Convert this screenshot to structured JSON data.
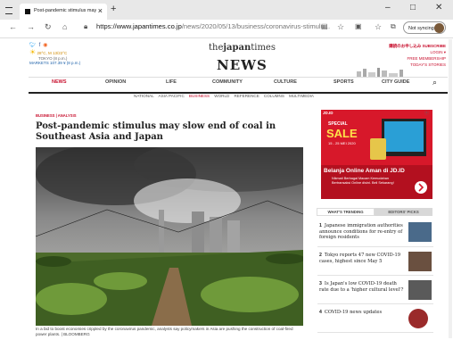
{
  "browser": {
    "tab_title": "Post-pandemic stimulus may slo",
    "new_tab": "+",
    "url_scheme": "https://",
    "url_domain": "www.japantimes.co.jp",
    "url_path": "/news/2020/05/13/business/coronavirus-stimulu...",
    "sync_label": "Not syncing",
    "window_min": "–",
    "window_max": "□",
    "window_close": "✕"
  },
  "header": {
    "weather_temp": "28°C, M 13/22°C",
    "weather_city": "TOKYO (8 p.m.)",
    "markets": "MARKETS  107.39 ¥ (8 p.m.)",
    "logo_the": "the",
    "logo_japan": "japan",
    "logo_times": "times",
    "section": "NEWS",
    "right_links": [
      "購読のお申し込み SUBSCRIBE",
      "LOGIN ▾",
      "FREE MEMBERSHIP",
      "TODAY'S STORIES"
    ]
  },
  "main_nav": [
    "NEWS",
    "OPINION",
    "LIFE",
    "COMMUNITY",
    "CULTURE",
    "SPORTS",
    "CITY GUIDE"
  ],
  "sub_nav": [
    "NATIONAL",
    "ASIA PACIFIC",
    "BUSINESS",
    "WORLD",
    "REFERENCE",
    "COLUMNS",
    "MULTIMEDIA"
  ],
  "sub_nav_active": "BUSINESS",
  "article": {
    "breadcrumb": "BUSINESS | ANALYSIS",
    "headline": "Post-pandemic stimulus may slow end of coal in Southeast Asia and Japan",
    "caption": "In a bid to boost economies crippled by the coronavirus pandemic, analysts say policymakers in Asia are pushing the construction of coal-fired power plants. | BLOOMBERG"
  },
  "ad": {
    "sale_line1": "SPECIAL",
    "sale_line2": "SALE",
    "dates": "15 - 25 MEI 2020",
    "headline": "Belanja Online Aman di JD.ID",
    "sub": "Nikmati Berbagai Macam Kemudahan Bertransaksi Online disini. Beli Sekarang!",
    "brand": "JD.ID"
  },
  "sidebar": {
    "tab_trending": "WHAT'S TRENDING",
    "tab_editors": "EDITORS' PICKS",
    "trending": [
      {
        "rank": "1",
        "title": "Japanese immigration authorities announce conditions for re-entry of foreign residents"
      },
      {
        "rank": "2",
        "title": "Tokyo reports 47 new COVID-19 cases, highest since May 5"
      },
      {
        "rank": "3",
        "title": "Is Japan's low COVID-19 death rate due to a 'higher cultural level'?"
      },
      {
        "rank": "4",
        "title": "COVID-19 news updates"
      }
    ]
  },
  "colors": {
    "accent": "#c8102e",
    "ad_bg": "#d7182a",
    "nav_dark": "#222222"
  }
}
